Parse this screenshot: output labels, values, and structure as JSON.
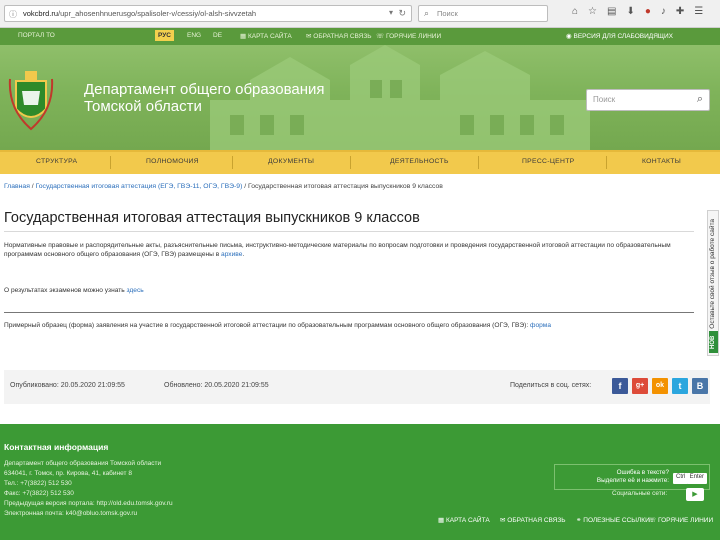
{
  "browser": {
    "url_host": "vokcbrd.ru",
    "url_path": "/upr_ahosenhnuerusgo/spalisoler-v/cessiy/ol-alsh-sivvzetah",
    "search_placeholder": "Поиск"
  },
  "top_strip": {
    "portal": "ПОРТАЛ ТО",
    "lang_ru": "РУС",
    "lang_en": "ENG",
    "lang_de": "DE",
    "sitemap": "КАРТА САЙТА",
    "feedback": "ОБРАТНАЯ СВЯЗЬ",
    "reception": "ГОРЯЧИЕ ЛИНИИ",
    "blind_version": "ВЕРСИЯ ДЛЯ СЛАБОВИДЯЩИХ"
  },
  "header": {
    "title_line1": "Департамент общего образования",
    "title_line2": "Томской области",
    "search_placeholder": "Поиск"
  },
  "nav": {
    "items": [
      "СТРУКТУРА",
      "ПОЛНОМОЧИЯ",
      "ДОКУМЕНТЫ",
      "ДЕЯТЕЛЬНОСТЬ",
      "ПРЕСС-ЦЕНТР",
      "КОНТАКТЫ"
    ]
  },
  "breadcrumb": {
    "home": "Главная",
    "parent": "Государственная итоговая аттестация (ЕГЭ, ГВЭ-11, ОГЭ, ГВЭ-9)",
    "current": "Государственная итоговая аттестация выпускников 9 классов"
  },
  "content": {
    "title": "Государственная итоговая аттестация выпускников 9 классов",
    "intro_text": "Нормативные правовые и распорядительные акты, разъяснительные письма, инструктивно-методические материалы по вопросам подготовки и проведения государственной итоговой аттестации по образовательным программам основного общего образования (ОГЭ, ГВЭ) размещены в",
    "intro_link": "архиве",
    "results_text": "О результатах экзаменов можно узнать",
    "results_link": "здесь",
    "sample_text": "Примерный образец (форма) заявления на участие в государственной итоговой аттестации по образовательным программам основного общего образования (ОГЭ, ГВЭ):",
    "sample_link": "форма"
  },
  "side_tab": {
    "text": "Оставьте свой отзыв о работе сайта",
    "badge": "НОВ"
  },
  "meta": {
    "published": "Опубликовано: 20.05.2020 21:09:55",
    "updated": "Обновлено: 20.05.2020 21:09:55",
    "share_label": "Поделиться в соц. сетях:"
  },
  "share_buttons": [
    "f",
    "g+",
    "ok",
    "t",
    "B"
  ],
  "colors": {
    "header_green": "#5a9a3c",
    "nav_yellow": "#f2c94c",
    "footer_green": "#3c9a35",
    "link_blue": "#2a6ebb",
    "facebook": "#3b5998",
    "google": "#dd4b39",
    "odnoklassniki": "#f39200",
    "twitter": "#2ba6de",
    "vk": "#4a76a8"
  },
  "footer": {
    "title": "Контактная информация",
    "org": "Департамент общего образования Томской области",
    "address": "634041, г. Томск, пр. Кирова, 41, кабинет 8",
    "phone": "Тел.: +7(3822) 512 530",
    "fax": "Факс: +7(3822) 512 530",
    "old_version": "Предыдущая версия портала: http://old.edu.tomsk.gov.ru",
    "email": "Электронная почта: k40@obluo.tomsk.gov.ru",
    "error_text_line1": "Ошибка в тексте?",
    "error_text_line2": "Выделите её и нажмите:",
    "key_ctrl": "Ctrl",
    "key_enter": "Enter",
    "mobile_label": "Социальные сети:",
    "nav": [
      "КАРТА САЙТА",
      "ОБРАТНАЯ СВЯЗЬ",
      "ПОЛЕЗНЫЕ ССЫЛКИ",
      "ГОРЯЧИЕ ЛИНИИ"
    ]
  }
}
